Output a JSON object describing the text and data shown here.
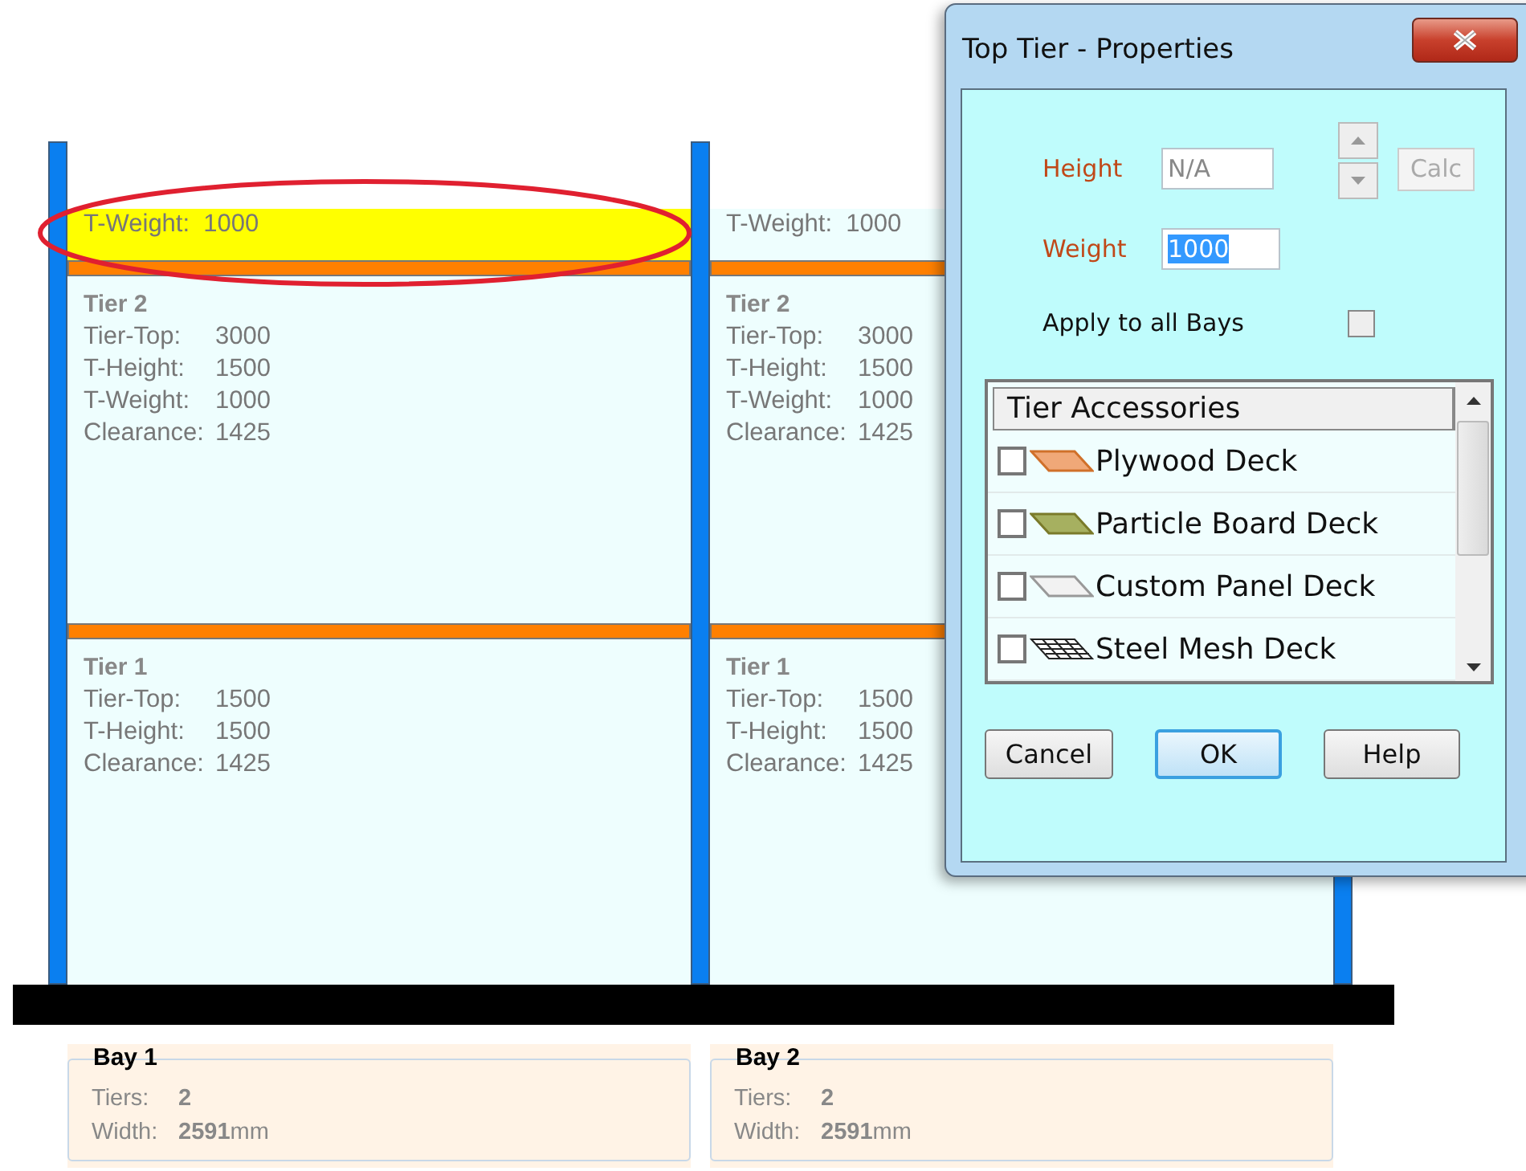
{
  "bays": [
    {
      "top_tier": {
        "text": "T-Weight:  1000",
        "selected": true
      },
      "tiers": [
        {
          "title": "Tier 2",
          "lines": [
            {
              "label": "Tier-Top:",
              "value": "3000"
            },
            {
              "label": "T-Height:",
              "value": "1500"
            },
            {
              "label": "T-Weight:",
              "value": "1000"
            },
            {
              "label": "Clearance:",
              "value": "1425"
            }
          ]
        },
        {
          "title": "Tier 1",
          "lines": [
            {
              "label": "Tier-Top:",
              "value": "1500"
            },
            {
              "label": "T-Height:",
              "value": "1500"
            },
            {
              "label": "Clearance:",
              "value": "1425"
            }
          ]
        }
      ],
      "info": {
        "title": "Bay 1",
        "tiers_label": "Tiers:",
        "tiers_value": "2",
        "width_label": "Width:",
        "width_value": "2591",
        "width_unit": "mm"
      }
    },
    {
      "top_tier": {
        "text": "T-Weight:  1000",
        "selected": false
      },
      "tiers": [
        {
          "title": "Tier 2",
          "lines": [
            {
              "label": "Tier-Top:",
              "value": "3000"
            },
            {
              "label": "T-Height:",
              "value": "1500"
            },
            {
              "label": "T-Weight:",
              "value": "1000"
            },
            {
              "label": "Clearance:",
              "value": "1425"
            }
          ]
        },
        {
          "title": "Tier 1",
          "lines": [
            {
              "label": "Tier-Top:",
              "value": "1500"
            },
            {
              "label": "T-Height:",
              "value": "1500"
            },
            {
              "label": "Clearance:",
              "value": "1425"
            }
          ]
        }
      ],
      "info": {
        "title": "Bay 2",
        "tiers_label": "Tiers:",
        "tiers_value": "2",
        "width_label": "Width:",
        "width_value": "2591",
        "width_unit": "mm"
      }
    }
  ],
  "dialog": {
    "title": "Top Tier - Properties",
    "height": {
      "label": "Height",
      "value": "N/A",
      "disabled": true
    },
    "calc": {
      "label": "Calc",
      "disabled": true
    },
    "weight": {
      "label": "Weight",
      "value": "1000",
      "selected": true
    },
    "apply_all": {
      "label": "Apply to all Bays",
      "checked": false
    },
    "accessories": {
      "header": "Tier Accessories",
      "items": [
        {
          "label": "Plywood Deck",
          "kind": "plywood",
          "checked": false
        },
        {
          "label": "Particle Board Deck",
          "kind": "particle",
          "checked": false
        },
        {
          "label": "Custom Panel Deck",
          "kind": "custom",
          "checked": false
        },
        {
          "label": "Steel Mesh Deck",
          "kind": "mesh",
          "checked": false
        }
      ]
    },
    "buttons": [
      {
        "label": "Cancel",
        "default": false
      },
      {
        "label": "OK",
        "default": true
      },
      {
        "label": "Help",
        "default": false
      }
    ]
  }
}
